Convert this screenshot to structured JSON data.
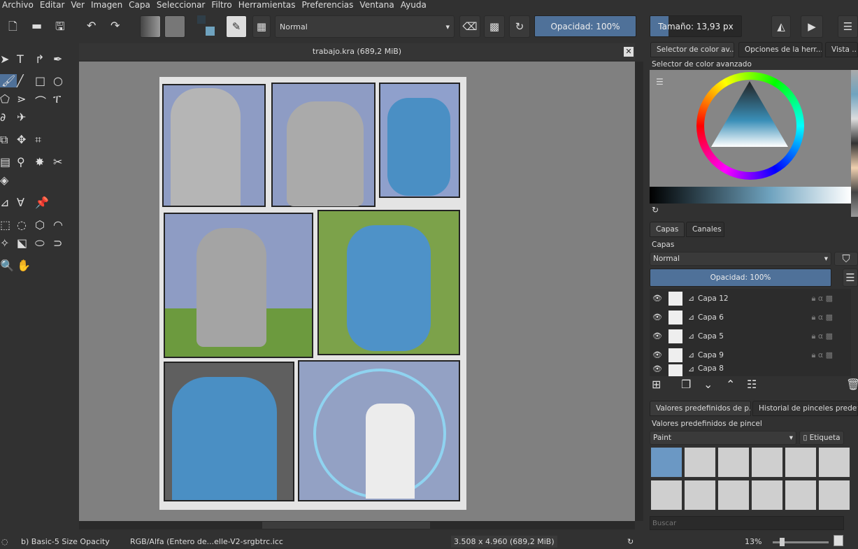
{
  "menu": [
    "Archivo",
    "Editar",
    "Ver",
    "Imagen",
    "Capa",
    "Seleccionar",
    "Filtro",
    "Herramientas",
    "Preferencias",
    "Ventana",
    "Ayuda"
  ],
  "toolbar": {
    "blend_mode": "Normal",
    "opacity": "Opacidad: 100%",
    "size": "Tamaño: 13,93 px",
    "size_fill_fraction": 0.2
  },
  "document": {
    "title": "trabajo.kra (689,2 MiB)"
  },
  "dock_tabs": [
    "Selector de color av...",
    "Opciones de la herr...",
    "Vista ..."
  ],
  "color_selector": {
    "title": "Selector de color avanzado"
  },
  "layers": {
    "tabs": [
      "Capas",
      "Canales"
    ],
    "title": "Capas",
    "blend": "Normal",
    "opacity": "Opacidad:  100%",
    "items": [
      "Capa 12",
      "Capa 6",
      "Capa 5",
      "Capa 9",
      "Capa 8"
    ]
  },
  "presets": {
    "tabs": [
      "Valores predefinidos de p...",
      "Historial de pinceles predefin..."
    ],
    "title": "Valores predefinidos de pincel",
    "filter": "Paint",
    "tag": "Etiqueta",
    "search_placeholder": "Buscar"
  },
  "status": {
    "brush": "b) Basic-5 Size Opacity",
    "color_space": "RGB/Alfa (Entero de...elle-V2-srgbtrc.icc",
    "dimensions": "3.508 x 4.960 (689,2 MiB)",
    "zoom": "13%"
  },
  "colors": {
    "accent": "#4f7199",
    "fg": "#2f3e48",
    "bg": "#6fa3bf"
  }
}
